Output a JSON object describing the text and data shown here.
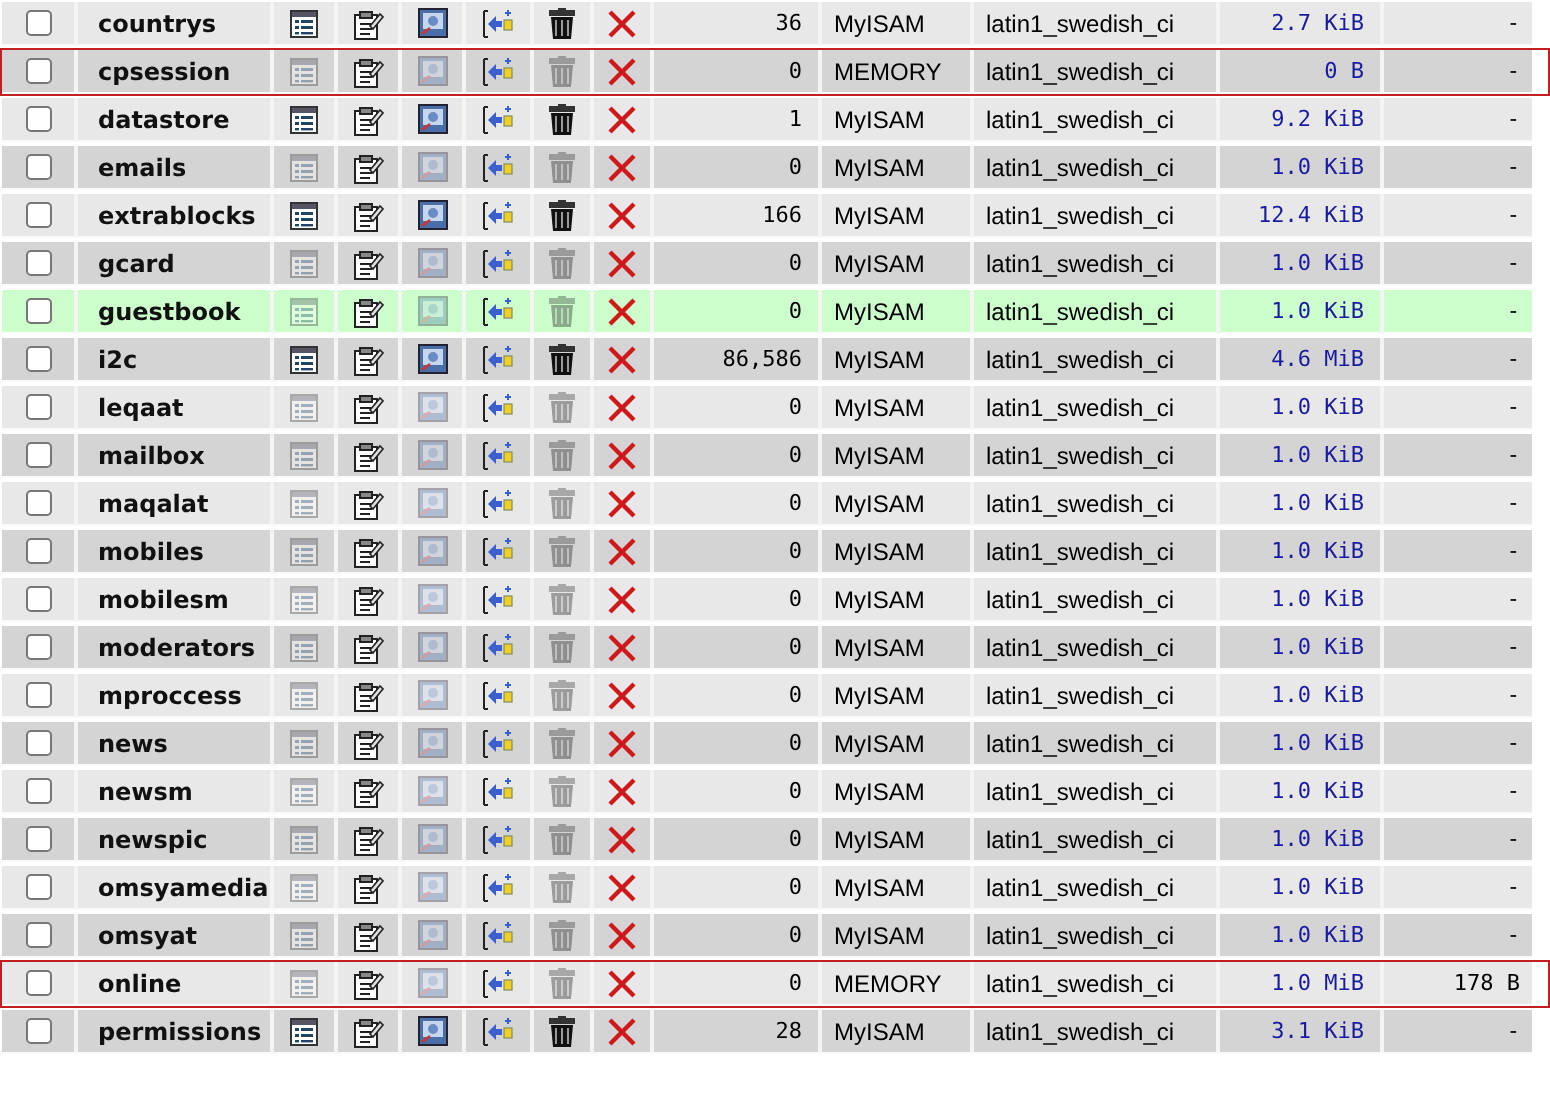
{
  "tables": [
    {
      "name": "countrys",
      "records": "36",
      "engine": "MyISAM",
      "collation": "latin1_swedish_ci",
      "size": "2.7 KiB",
      "overhead": "-",
      "empty": false,
      "outlined": false,
      "marked": false
    },
    {
      "name": "cpsession",
      "records": "0",
      "engine": "MEMORY",
      "collation": "latin1_swedish_ci",
      "size": "0 B",
      "overhead": "-",
      "empty": true,
      "outlined": true,
      "marked": false
    },
    {
      "name": "datastore",
      "records": "1",
      "engine": "MyISAM",
      "collation": "latin1_swedish_ci",
      "size": "9.2 KiB",
      "overhead": "-",
      "empty": false,
      "outlined": false,
      "marked": false
    },
    {
      "name": "emails",
      "records": "0",
      "engine": "MyISAM",
      "collation": "latin1_swedish_ci",
      "size": "1.0 KiB",
      "overhead": "-",
      "empty": true,
      "outlined": false,
      "marked": false
    },
    {
      "name": "extrablocks",
      "records": "166",
      "engine": "MyISAM",
      "collation": "latin1_swedish_ci",
      "size": "12.4 KiB",
      "overhead": "-",
      "empty": false,
      "outlined": false,
      "marked": false
    },
    {
      "name": "gcard",
      "records": "0",
      "engine": "MyISAM",
      "collation": "latin1_swedish_ci",
      "size": "1.0 KiB",
      "overhead": "-",
      "empty": true,
      "outlined": false,
      "marked": false
    },
    {
      "name": "guestbook",
      "records": "0",
      "engine": "MyISAM",
      "collation": "latin1_swedish_ci",
      "size": "1.0 KiB",
      "overhead": "-",
      "empty": true,
      "outlined": false,
      "marked": true
    },
    {
      "name": "i2c",
      "records": "86,586",
      "engine": "MyISAM",
      "collation": "latin1_swedish_ci",
      "size": "4.6 MiB",
      "overhead": "-",
      "empty": false,
      "outlined": false,
      "marked": false
    },
    {
      "name": "leqaat",
      "records": "0",
      "engine": "MyISAM",
      "collation": "latin1_swedish_ci",
      "size": "1.0 KiB",
      "overhead": "-",
      "empty": true,
      "outlined": false,
      "marked": false
    },
    {
      "name": "mailbox",
      "records": "0",
      "engine": "MyISAM",
      "collation": "latin1_swedish_ci",
      "size": "1.0 KiB",
      "overhead": "-",
      "empty": true,
      "outlined": false,
      "marked": false
    },
    {
      "name": "maqalat",
      "records": "0",
      "engine": "MyISAM",
      "collation": "latin1_swedish_ci",
      "size": "1.0 KiB",
      "overhead": "-",
      "empty": true,
      "outlined": false,
      "marked": false
    },
    {
      "name": "mobiles",
      "records": "0",
      "engine": "MyISAM",
      "collation": "latin1_swedish_ci",
      "size": "1.0 KiB",
      "overhead": "-",
      "empty": true,
      "outlined": false,
      "marked": false
    },
    {
      "name": "mobilesm",
      "records": "0",
      "engine": "MyISAM",
      "collation": "latin1_swedish_ci",
      "size": "1.0 KiB",
      "overhead": "-",
      "empty": true,
      "outlined": false,
      "marked": false
    },
    {
      "name": "moderators",
      "records": "0",
      "engine": "MyISAM",
      "collation": "latin1_swedish_ci",
      "size": "1.0 KiB",
      "overhead": "-",
      "empty": true,
      "outlined": false,
      "marked": false
    },
    {
      "name": "mproccess",
      "records": "0",
      "engine": "MyISAM",
      "collation": "latin1_swedish_ci",
      "size": "1.0 KiB",
      "overhead": "-",
      "empty": true,
      "outlined": false,
      "marked": false
    },
    {
      "name": "news",
      "records": "0",
      "engine": "MyISAM",
      "collation": "latin1_swedish_ci",
      "size": "1.0 KiB",
      "overhead": "-",
      "empty": true,
      "outlined": false,
      "marked": false
    },
    {
      "name": "newsm",
      "records": "0",
      "engine": "MyISAM",
      "collation": "latin1_swedish_ci",
      "size": "1.0 KiB",
      "overhead": "-",
      "empty": true,
      "outlined": false,
      "marked": false
    },
    {
      "name": "newspic",
      "records": "0",
      "engine": "MyISAM",
      "collation": "latin1_swedish_ci",
      "size": "1.0 KiB",
      "overhead": "-",
      "empty": true,
      "outlined": false,
      "marked": false
    },
    {
      "name": "omsyamedia",
      "records": "0",
      "engine": "MyISAM",
      "collation": "latin1_swedish_ci",
      "size": "1.0 KiB",
      "overhead": "-",
      "empty": true,
      "outlined": false,
      "marked": false
    },
    {
      "name": "omsyat",
      "records": "0",
      "engine": "MyISAM",
      "collation": "latin1_swedish_ci",
      "size": "1.0 KiB",
      "overhead": "-",
      "empty": true,
      "outlined": false,
      "marked": false
    },
    {
      "name": "online",
      "records": "0",
      "engine": "MEMORY",
      "collation": "latin1_swedish_ci",
      "size": "1.0 MiB",
      "overhead": "178 B",
      "empty": true,
      "outlined": true,
      "marked": false
    },
    {
      "name": "permissions",
      "records": "28",
      "engine": "MyISAM",
      "collation": "latin1_swedish_ci",
      "size": "3.1 KiB",
      "overhead": "-",
      "empty": false,
      "outlined": false,
      "marked": false
    }
  ]
}
